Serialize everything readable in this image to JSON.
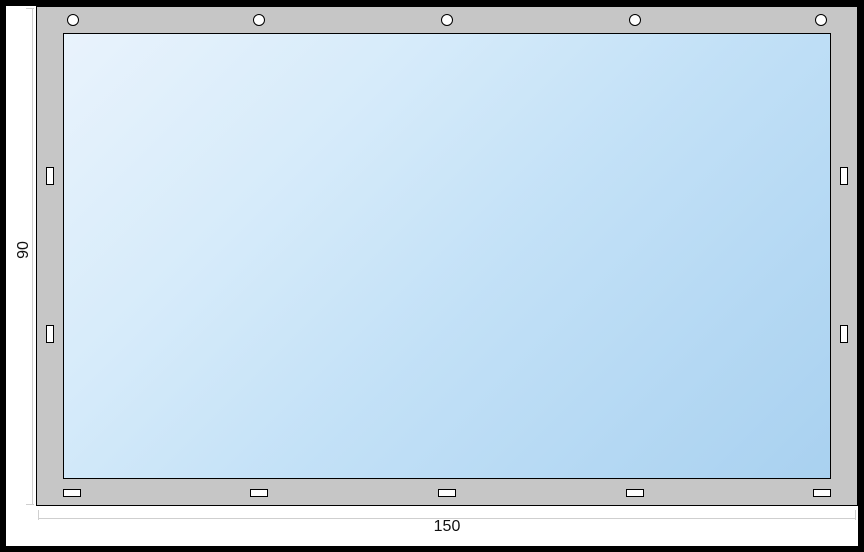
{
  "diagram": {
    "width_label": "150",
    "height_label": "90",
    "frame_color": "#c6c6c6",
    "glass_gradient": [
      "#e9f3fc",
      "#a9d1f0"
    ],
    "top_grommets": 5,
    "side_lugs_per_side": 2,
    "bottom_lugs": 5
  }
}
